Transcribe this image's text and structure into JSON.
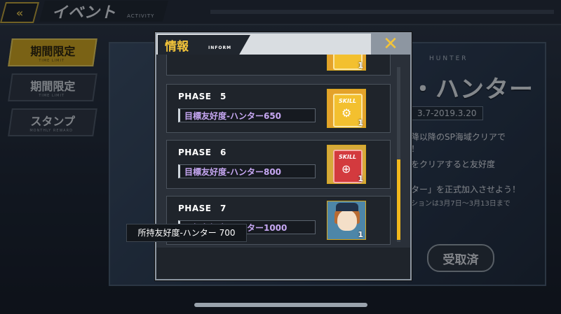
{
  "header": {
    "back_icon": "double-chevron-left-icon",
    "title": "イベント",
    "subtitle": "ACTIVITY"
  },
  "sidebar": {
    "items": [
      {
        "label": "期間限定",
        "sub": "TIME LIMIT",
        "active": true
      },
      {
        "label": "期間限定",
        "sub": "TIME LIMIT",
        "active": false
      },
      {
        "label": "スタンプ",
        "sub": "MONTHLY REWARD",
        "active": false
      }
    ]
  },
  "banner": {
    "hunter_en": "HUNTER",
    "title": "・ハンター",
    "date": "3.7-2019.3.20",
    "line1": "降以降のSP海域クリアで",
    "line2": "！",
    "line3": "をクリアすると友好度",
    "line4": "ター」を正式加入させよう！",
    "line5": "ションは3月7日～3月13日まで",
    "receive_button": "受取済"
  },
  "dialog": {
    "title": "情報",
    "subtitle": "INFORM",
    "close_icon": "close-x-icon",
    "phases": [
      {
        "phase": "PHASE　5",
        "goal": "目標友好度-ハンター650",
        "reward_icon": "skill-book-gold-icon",
        "count": "1"
      },
      {
        "phase": "PHASE　6",
        "goal": "目標友好度-ハンター800",
        "reward_icon": "skill-book-red-icon",
        "count": "1"
      },
      {
        "phase": "PHASE　7",
        "goal": "目標友好度-ハンター1000",
        "reward_icon": "character-hunter-portrait-icon",
        "count": "1"
      }
    ],
    "partial_row_count": "1",
    "favor": "所持友好度-ハンター 700"
  },
  "colors": {
    "accent_gold": "#f3c43a",
    "goal_text": "#c6a7f2",
    "scroll_thumb": "#f2b81c"
  }
}
